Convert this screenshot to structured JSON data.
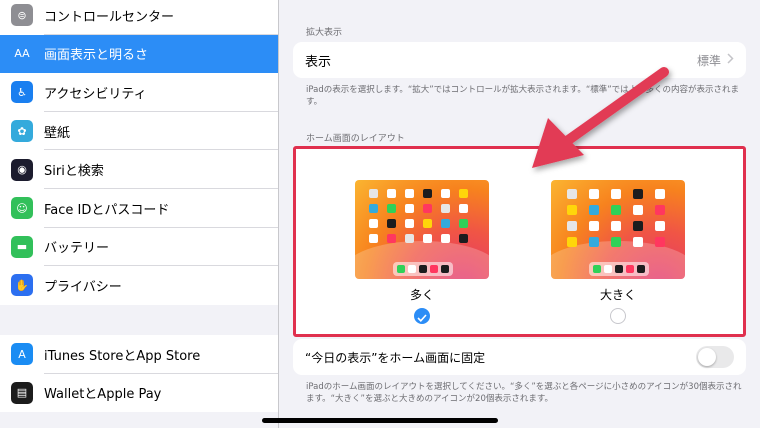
{
  "sidebar": {
    "items": [
      {
        "label": "コントロールセンター",
        "icon": "control-center-icon",
        "color": "#8e8e93",
        "glyph": "⊜"
      },
      {
        "label": "画面表示と明るさ",
        "icon": "display-brightness-icon",
        "color": "#2c8df6",
        "glyph": "AA",
        "active": true
      },
      {
        "label": "アクセシビリティ",
        "icon": "accessibility-icon",
        "color": "#1a7ff0",
        "glyph": "♿"
      },
      {
        "label": "壁紙",
        "icon": "wallpaper-icon",
        "color": "#34aadc",
        "glyph": "✿"
      },
      {
        "label": "Siriと検索",
        "icon": "siri-icon",
        "color": "#1c1c2e",
        "glyph": "◉"
      },
      {
        "label": "Face IDとパスコード",
        "icon": "face-id-icon",
        "color": "#32c05a",
        "glyph": "☺"
      },
      {
        "label": "バッテリー",
        "icon": "battery-icon",
        "color": "#32c05a",
        "glyph": "▬"
      },
      {
        "label": "プライバシー",
        "icon": "privacy-hand-icon",
        "color": "#2c6ff0",
        "glyph": "✋"
      }
    ],
    "items2": [
      {
        "label": "iTunes StoreとApp Store",
        "icon": "app-store-icon",
        "color": "#1a8cf3",
        "glyph": "A"
      },
      {
        "label": "WalletとApple Pay",
        "icon": "wallet-icon",
        "color": "#1c1c1c",
        "glyph": "▤"
      }
    ]
  },
  "main": {
    "zoom_header": "拡大表示",
    "display_label": "表示",
    "display_value": "標準",
    "zoom_note": "iPadの表示を選択します。“拡大”ではコントロールが拡大表示されます。“標準”ではより多くの内容が表示されます。",
    "layout_header": "ホーム画面のレイアウト",
    "option_more": "多く",
    "option_bigger": "大きく",
    "selected": "多く",
    "today_label": "“今日の表示”をホーム画面に固定",
    "today_toggle": "off",
    "layout_note": "iPadのホーム画面のレイアウトを選択してください。“多く”を選ぶと各ページに小さめのアイコンが30個表示されます。“大きく”を選ぶと大きめのアイコンが20個表示されます。"
  },
  "colors": {
    "accent": "#2c8df6",
    "highlight": "#e0304e",
    "arrow": "#e23a55"
  }
}
